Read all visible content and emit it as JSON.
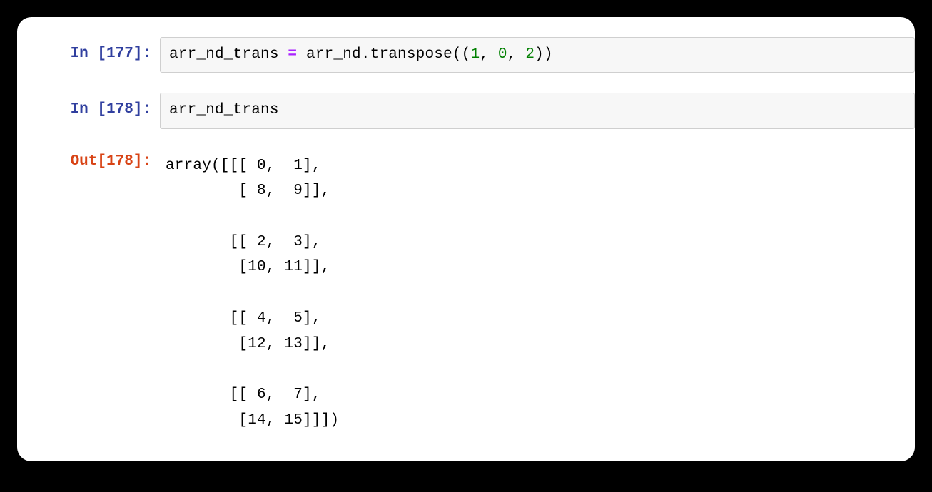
{
  "cells": {
    "in177": {
      "prompt": "In [177]:",
      "code": {
        "lhs": "arr_nd_trans",
        "assign": " = ",
        "obj": "arr_nd",
        "dot": ".",
        "method": "transpose",
        "open": "((",
        "n1": "1",
        "c1": ", ",
        "n2": "0",
        "c2": ", ",
        "n3": "2",
        "close": "))"
      }
    },
    "in178": {
      "prompt": "In [178]:",
      "code": "arr_nd_trans"
    },
    "out178": {
      "prompt": "Out[178]:",
      "text": "array([[[ 0,  1],\n        [ 8,  9]],\n\n       [[ 2,  3],\n        [10, 11]],\n\n       [[ 4,  5],\n        [12, 13]],\n\n       [[ 6,  7],\n        [14, 15]]])"
    }
  }
}
